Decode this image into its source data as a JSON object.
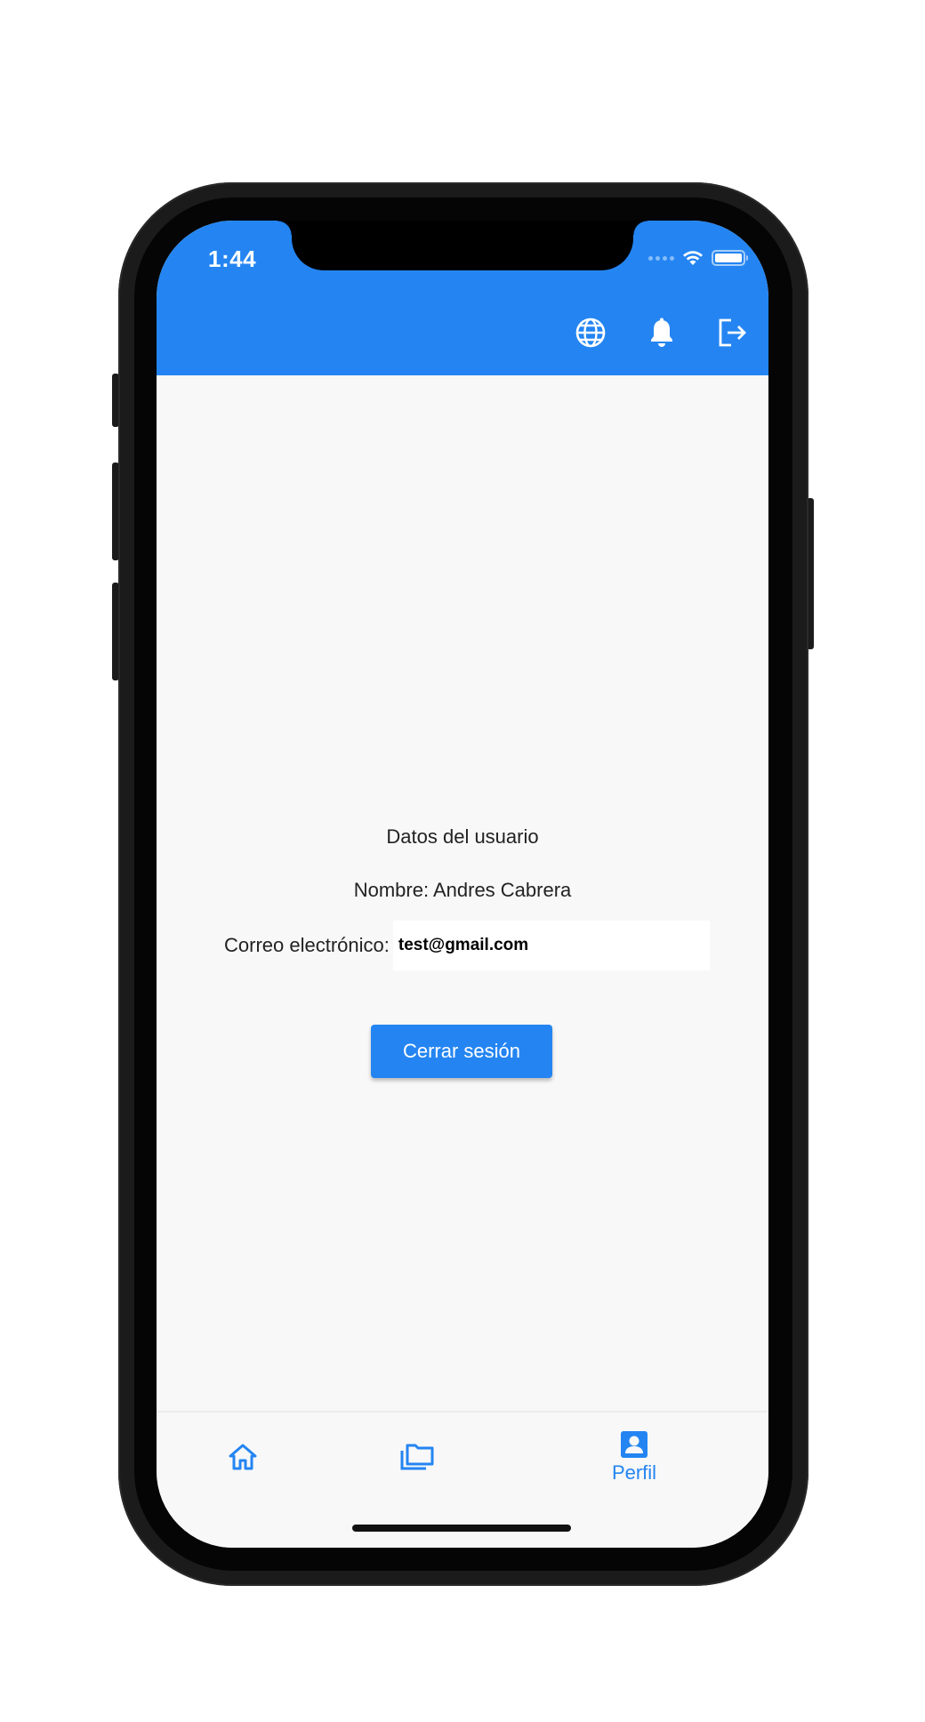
{
  "status_bar": {
    "time": "1:44"
  },
  "app_bar": {
    "actions": [
      {
        "icon": "globe-icon"
      },
      {
        "icon": "bell-icon"
      },
      {
        "icon": "logout-icon"
      }
    ],
    "color": "#2485f2"
  },
  "profile": {
    "section_title": "Datos del usuario",
    "name_line": "Nombre: Andres Cabrera",
    "email_label": "Correo electrónico:",
    "email_value": "test@gmail.com"
  },
  "logout_button": {
    "label": "Cerrar sesión"
  },
  "bottom_nav": {
    "items": [
      {
        "icon": "home-icon",
        "label": ""
      },
      {
        "icon": "folders-icon",
        "label": ""
      },
      {
        "icon": "profile-icon",
        "label": "Perfil",
        "selected": true
      }
    ],
    "accent": "#2485f2"
  }
}
